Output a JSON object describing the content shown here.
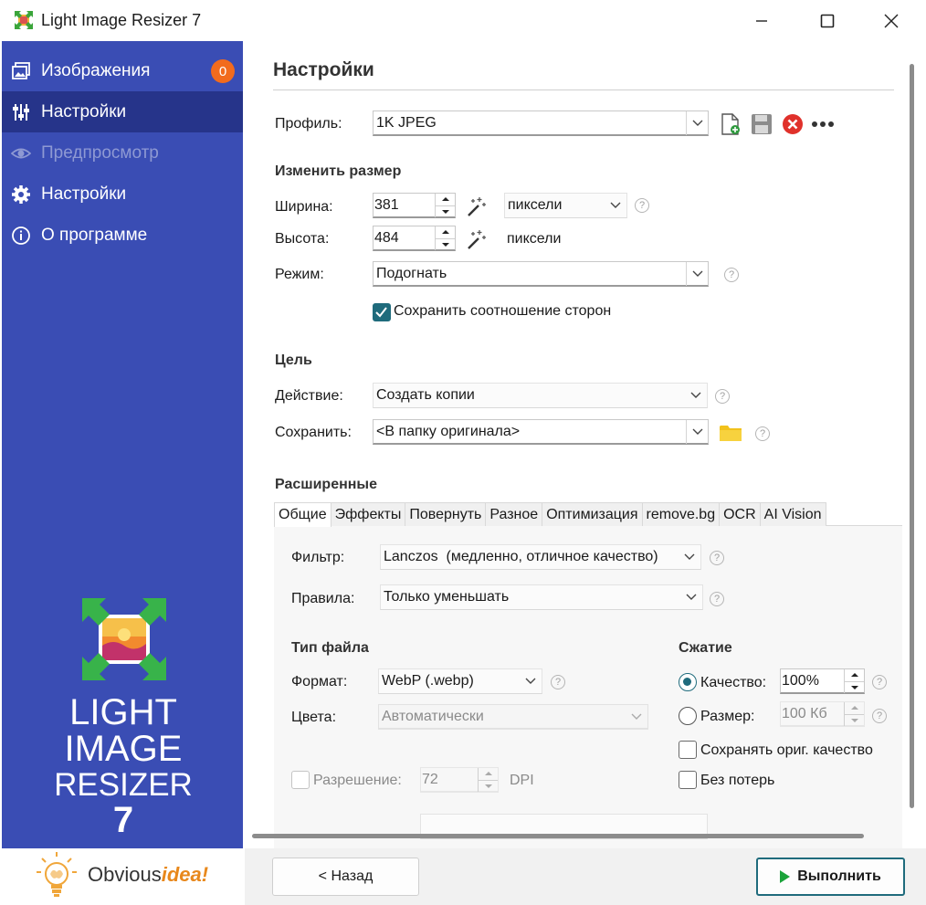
{
  "window": {
    "title": "Light Image Resizer 7"
  },
  "sidebar": {
    "items": [
      {
        "label": "Изображения",
        "icon": "images-icon",
        "badge": "0"
      },
      {
        "label": "Настройки",
        "icon": "sliders-icon"
      },
      {
        "label": "Предпросмотр",
        "icon": "eye-icon"
      },
      {
        "label": "Настройки",
        "icon": "gear-icon"
      },
      {
        "label": "О программе",
        "icon": "info-icon"
      }
    ],
    "logo_lines": [
      "LIGHT",
      "IMAGE",
      "RESIZER",
      "7"
    ],
    "brand": {
      "text": "Obvious",
      "accent": "idea!"
    }
  },
  "main": {
    "heading": "Настройки",
    "profile": {
      "label": "Профиль:",
      "value": "1K JPEG"
    },
    "resize": {
      "heading": "Изменить размер",
      "width_label": "Ширина:",
      "width_value": "381",
      "unit": "пиксели",
      "height_label": "Высота:",
      "height_value": "484",
      "height_unit": "пиксели",
      "mode_label": "Режим:",
      "mode_value": "Подогнать",
      "keep_ratio_label": "Сохранить соотношение сторон",
      "keep_ratio_checked": true
    },
    "target": {
      "heading": "Цель",
      "action_label": "Действие:",
      "action_value": "Создать копии",
      "save_label": "Сохранить:",
      "save_value": "<В папку оригинала>"
    },
    "advanced": {
      "heading": "Расширенные",
      "tabs": [
        "Общие",
        "Эффекты",
        "Повернуть",
        "Разное",
        "Оптимизация",
        "remove.bg",
        "OCR",
        "AI Vision"
      ],
      "active_tab": "Общие",
      "filter_label": "Фильтр:",
      "filter_value": "Lanczos  (медленно, отличное качество)",
      "rules_label": "Правила:",
      "rules_value": "Только уменьшать",
      "filetype_heading": "Тип файла",
      "format_label": "Формат:",
      "format_value": "WebP (.webp)",
      "colors_label": "Цвета:",
      "colors_value": "Автоматически",
      "resolution_label": "Разрешение:",
      "resolution_value": "72",
      "resolution_unit": "DPI",
      "partial_label": "",
      "partial_value": "",
      "compression_heading": "Сжатие",
      "quality_label": "Качество:",
      "quality_value": "100%",
      "size_label": "Размер:",
      "size_value": "100 Кб",
      "keep_quality_label": "Сохранять ориг. качество",
      "lossless_label": "Без потерь"
    }
  },
  "footer": {
    "back_label": "< Назад",
    "run_label": "Выполнить"
  },
  "colors": {
    "sidebar": "#3a4db4",
    "sidebar_active": "#26348a",
    "accent": "#1f6b7c",
    "badge": "#f26b1d",
    "run_icon": "#1aa33a"
  }
}
